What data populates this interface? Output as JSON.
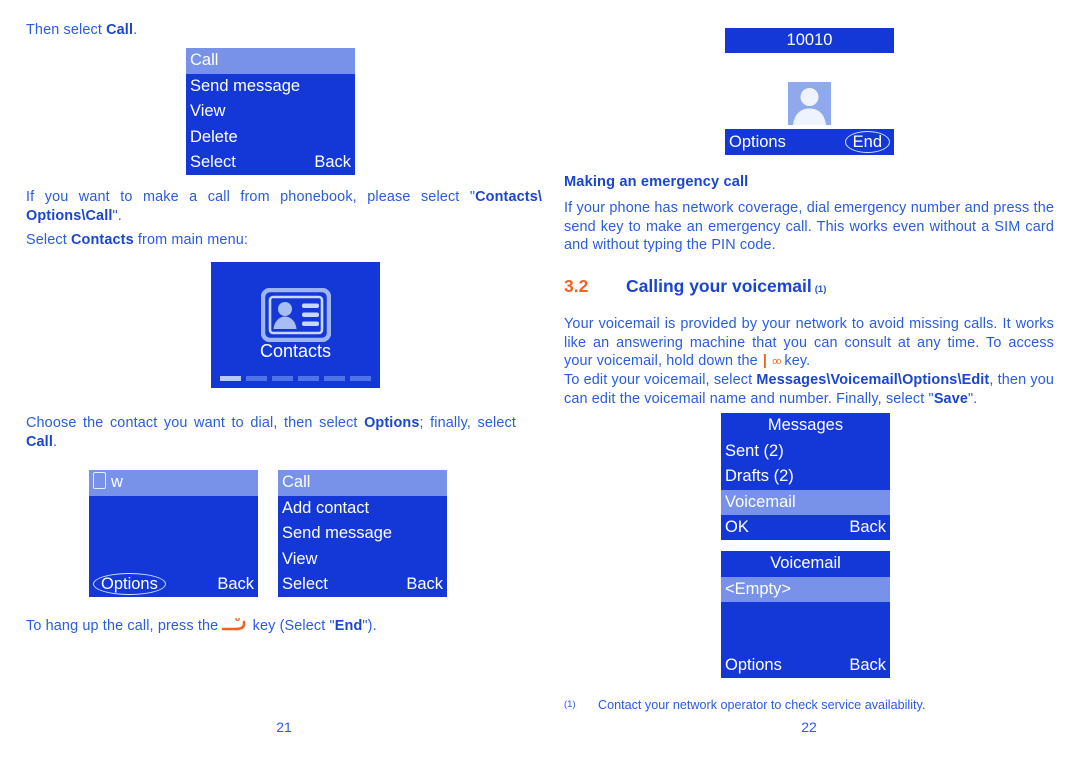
{
  "document": {
    "left_page_number": "21",
    "right_page_number": "22"
  },
  "left_column": {
    "intro_line": {
      "prefix": "Then select ",
      "bold": "Call",
      "suffix": "."
    },
    "options_menu_screen": {
      "name": "call-options-menu",
      "items": [
        "Call",
        "Send message",
        "View",
        "Delete"
      ],
      "highlighted_index": 0,
      "softkey_left": "Select",
      "softkey_right": "Back"
    },
    "phonebook_paragraph": {
      "part1": "If you want to make a call from phonebook, please select \"",
      "bold1": "Contacts\\",
      "bold2": "Options\\Call",
      "part2": "\"."
    },
    "select_contacts_line": {
      "prefix": "Select ",
      "bold": "Contacts",
      "suffix": " from main menu:"
    },
    "contacts_screen": {
      "name": "contacts-main-menu",
      "label": "Contacts",
      "icon": "contacts-card-icon",
      "page_dots": 6,
      "active_dot_index": 0
    },
    "choose_contact_paragraph": {
      "part1": "Choose the contact you want to dial, then select ",
      "bold1": "Options",
      "part2": "; finally, select ",
      "bold2": "Call",
      "part3": "."
    },
    "contact_list_screen": {
      "name": "contact-entry-screen",
      "header_icon": "sim-card-icon",
      "header_text": "w",
      "softkey_left": "Options",
      "softkey_right": "Back"
    },
    "contact_options_screen": {
      "name": "contact-options-menu",
      "items": [
        "Call",
        "Add contact",
        "Send message",
        "View"
      ],
      "highlighted_index": 0,
      "softkey_left": "Select",
      "softkey_right": "Back"
    },
    "hangup_paragraph": {
      "part1": "To hang up the call, press the ",
      "key_icon": "hangup-key-icon",
      "part2": " key (Select \"",
      "bold": "End",
      "part3": "\")."
    }
  },
  "right_column": {
    "in_call_screen": {
      "name": "in-call-screen",
      "number": "10010",
      "avatar_icon": "contact-avatar-icon",
      "softkey_left": "Options",
      "softkey_right": "End"
    },
    "emergency_heading": "Making an emergency call",
    "emergency_paragraph": "If your phone has network coverage, dial emergency number and press the send key to make an emergency call. This works even without a SIM card and without typing the PIN code.",
    "section": {
      "number": "3.2",
      "title": "Calling your voicemail",
      "footnote_mark": "(1)"
    },
    "voicemail_paragraph_1": {
      "part1": "Your voicemail is provided by your network to avoid missing calls. It works like an answering machine that you can consult at any time. To access your voicemail, hold down the ",
      "key_bar": "|",
      "key_oo": "oo",
      "part2": " key."
    },
    "voicemail_paragraph_2": {
      "part1": "To edit your voicemail, select ",
      "bold1": "Messages\\Voicemail\\Options\\Edit",
      "part2": ", then you can edit the voicemail name and number. Finally, select \"",
      "bold2": "Save",
      "part3": "\"."
    },
    "messages_screen": {
      "name": "messages-menu-screen",
      "title": "Messages",
      "items": [
        "Sent (2)",
        "Drafts (2)",
        "Voicemail"
      ],
      "highlighted_index": 2,
      "softkey_left": "OK",
      "softkey_right": "Back"
    },
    "voicemail_screen": {
      "name": "voicemail-list-screen",
      "title": "Voicemail",
      "items": [
        "<Empty>"
      ],
      "highlighted_index": 0,
      "softkey_left": "Options",
      "softkey_right": "Back"
    },
    "footnote": {
      "mark": "(1)",
      "text": "Contact your network operator to check service availability."
    }
  },
  "colors": {
    "text_blue": "#2a5ce0",
    "bold_blue": "#1a45d0",
    "accent_orange": "#f26322",
    "screen_bg": "#1438d8",
    "screen_highlight": "#7792e8",
    "screen_text": "#ffffff"
  }
}
